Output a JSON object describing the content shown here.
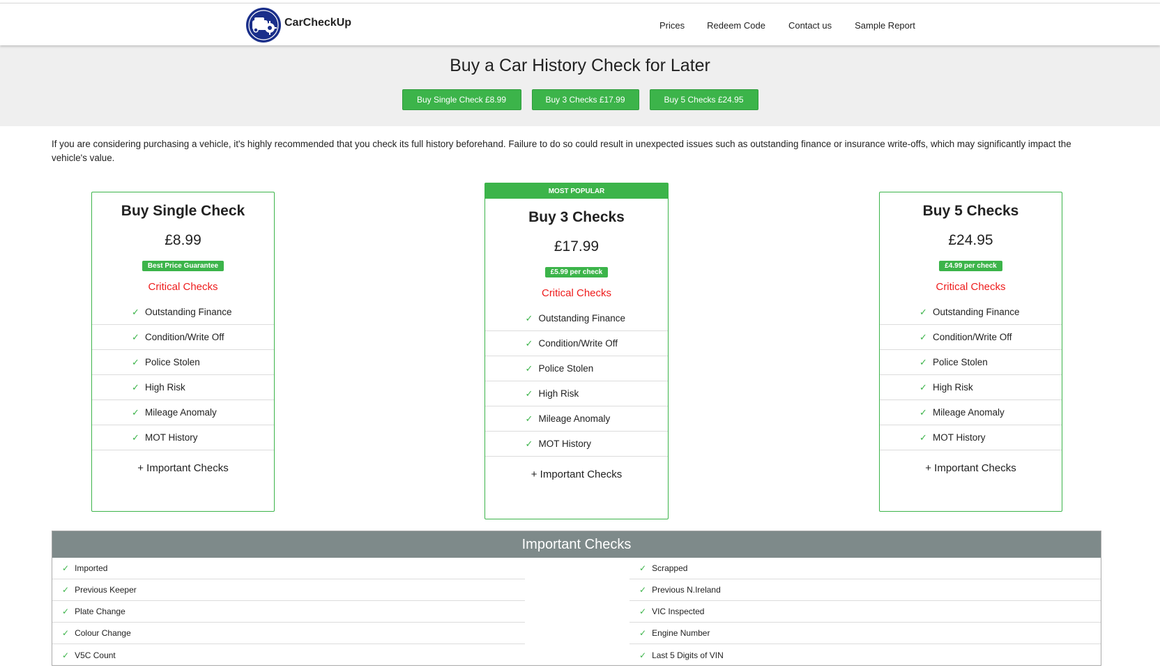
{
  "brand": {
    "name": "CarCheckUp",
    "logo_icon": "car-gear-logo"
  },
  "nav": {
    "items": [
      "Prices",
      "Redeem Code",
      "Contact us",
      "Sample Report"
    ]
  },
  "hero": {
    "title": "Buy a Car History Check for Later",
    "buttons": [
      "Buy Single Check £8.99",
      "Buy 3 Checks £17.99",
      "Buy 5 Checks £24.95"
    ]
  },
  "intro": "If you are considering purchasing a vehicle, it's highly recommended that you check its full history beforehand. Failure to do so could result in unexpected issues such as outstanding finance or insurance write-offs, which may significantly impact the vehicle's value.",
  "colors": {
    "accent_green": "#3cb44a",
    "critical_red": "#ee1c1c",
    "table_header": "#7e8a8a"
  },
  "cards": [
    {
      "badge": "",
      "title": "Buy Single Check",
      "price": "£8.99",
      "pill": "Best Price Guarantee",
      "critical_label": "Critical Checks",
      "features": [
        "Outstanding Finance",
        "Condition/Write Off",
        "Police Stolen",
        "High Risk",
        "Mileage Anomaly",
        "MOT History"
      ],
      "important_link": "+ Important Checks"
    },
    {
      "badge": "MOST POPULAR",
      "title": "Buy 3 Checks",
      "price": "£17.99",
      "pill": "£5.99 per check",
      "critical_label": "Critical Checks",
      "features": [
        "Outstanding Finance",
        "Condition/Write Off",
        "Police Stolen",
        "High Risk",
        "Mileage Anomaly",
        "MOT History"
      ],
      "important_link": "+ Important Checks"
    },
    {
      "badge": "",
      "title": "Buy 5 Checks",
      "price": "£24.95",
      "pill": "£4.99 per check",
      "critical_label": "Critical Checks",
      "features": [
        "Outstanding Finance",
        "Condition/Write Off",
        "Police Stolen",
        "High Risk",
        "Mileage Anomaly",
        "MOT History"
      ],
      "important_link": "+ Important Checks"
    }
  ],
  "important": {
    "title": "Important Checks",
    "left": [
      "Imported",
      "Previous Keeper",
      "Plate Change",
      "Colour Change",
      "V5C Count"
    ],
    "right": [
      "Scrapped",
      "Previous N.Ireland",
      "VIC Inspected",
      "Engine Number",
      "Last 5 Digits of VIN"
    ]
  }
}
